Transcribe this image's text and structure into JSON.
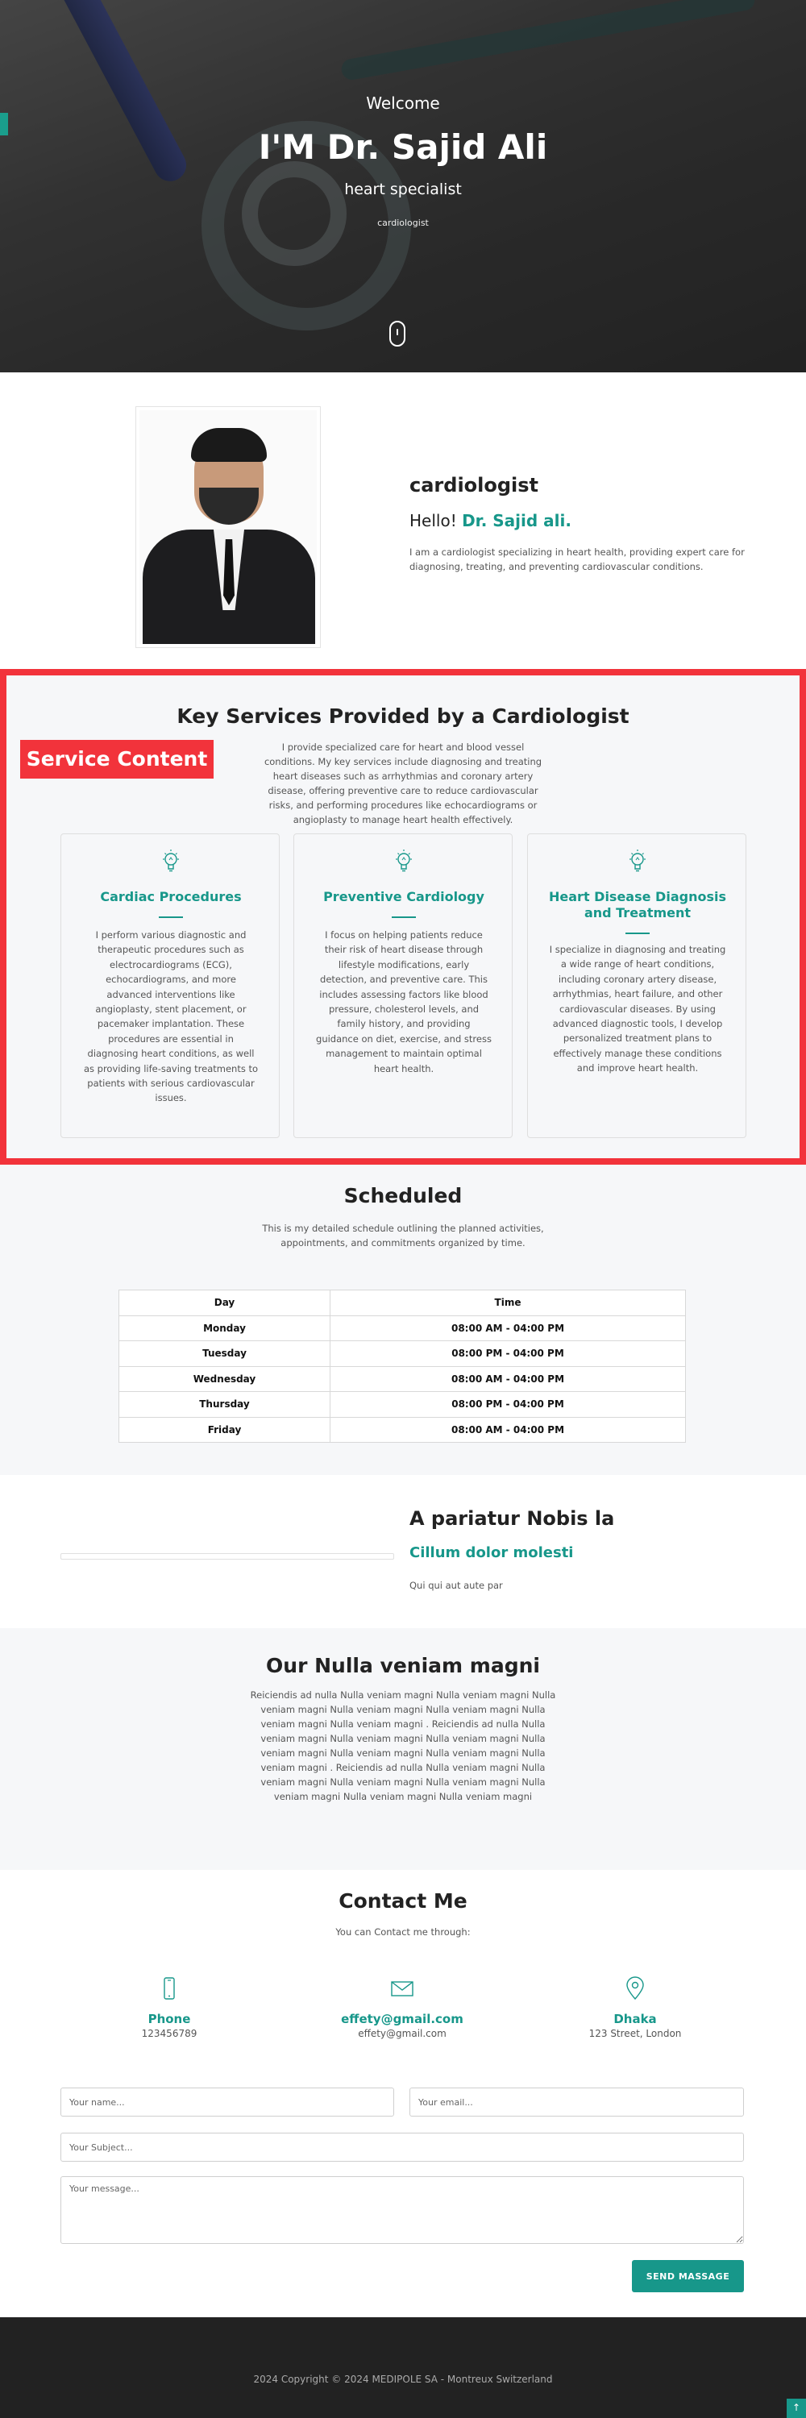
{
  "hero": {
    "welcome": "Welcome",
    "name": "I'M Dr. Sajid Ali",
    "subtitle": "heart specialist",
    "tagline": "cardiologist"
  },
  "about": {
    "title": "cardiologist",
    "hello_prefix": "Hello!",
    "hello_name": "Dr. Sajid ali.",
    "description": "I am a cardiologist specializing in heart health, providing expert care for diagnosing, treating, and preventing cardiovascular conditions."
  },
  "services": {
    "title": "Key Services Provided by a Cardiologist",
    "description": "I provide specialized care for heart and blood vessel conditions. My key services include diagnosing and treating heart diseases such as arrhythmias and coronary artery disease, offering preventive care to reduce cardiovascular risks, and performing procedures like echocardiograms or angioplasty to manage heart health effectively.",
    "badge": "Service Content",
    "cards": [
      {
        "icon": "lightbulb-icon",
        "title": "Cardiac Procedures",
        "text": "I perform various diagnostic and therapeutic procedures such as electrocardiograms (ECG), echocardiograms, and more advanced interventions like angioplasty, stent placement, or pacemaker implantation. These procedures are essential in diagnosing heart conditions, as well as providing life-saving treatments to patients with serious cardiovascular issues."
      },
      {
        "icon": "lightbulb-icon",
        "title": "Preventive Cardiology",
        "text": "I focus on helping patients reduce their risk of heart disease through lifestyle modifications, early detection, and preventive care. This includes assessing factors like blood pressure, cholesterol levels, and family history, and providing guidance on diet, exercise, and stress management to maintain optimal heart health."
      },
      {
        "icon": "lightbulb-icon",
        "title": "Heart Disease Diagnosis and Treatment",
        "text": "I specialize in diagnosing and treating a wide range of heart conditions, including coronary artery disease, arrhythmias, heart failure, and other cardiovascular diseases. By using advanced diagnostic tools, I develop personalized treatment plans to effectively manage these conditions and improve heart health."
      }
    ]
  },
  "schedule": {
    "title": "Scheduled",
    "description": "This is my detailed schedule outlining the planned activities, appointments, and commitments organized by time.",
    "headers": [
      "Day",
      "Time"
    ],
    "rows": [
      [
        "Monday",
        "08:00 AM - 04:00 PM"
      ],
      [
        "Tuesday",
        "08:00 PM - 04:00 PM"
      ],
      [
        "Wednesday",
        "08:00 AM - 04:00 PM"
      ],
      [
        "Thursday",
        "08:00 PM - 04:00 PM"
      ],
      [
        "Friday",
        "08:00 AM - 04:00 PM"
      ]
    ]
  },
  "feature": {
    "title": "A pariatur Nobis la",
    "subtitle": "Cillum dolor molesti",
    "text": "Qui qui aut aute par"
  },
  "our": {
    "title_prefix": "Our",
    "title_bold": "Nulla veniam magni",
    "text": "Reiciendis ad nulla Nulla veniam magni Nulla veniam magni Nulla veniam magni Nulla veniam magni Nulla veniam magni Nulla veniam magni Nulla veniam magni . Reiciendis ad nulla Nulla veniam magni Nulla veniam magni Nulla veniam magni Nulla veniam magni Nulla veniam magni Nulla veniam magni Nulla veniam magni . Reiciendis ad nulla Nulla veniam magni Nulla veniam magni Nulla veniam magni Nulla veniam magni Nulla veniam magni Nulla veniam magni Nulla veniam magni"
  },
  "contact": {
    "title": "Contact Me",
    "subtitle": "You can Contact me through:",
    "items": [
      {
        "icon": "phone-icon",
        "label": "Phone",
        "value": "123456789"
      },
      {
        "icon": "envelope-icon",
        "label": "effety@gmail.com",
        "value": "effety@gmail.com"
      },
      {
        "icon": "location-pin-icon",
        "label": "Dhaka",
        "value": "123 Street, London"
      }
    ],
    "form": {
      "name_placeholder": "Your name...",
      "email_placeholder": "Your email...",
      "subject_placeholder": "Your Subject...",
      "message_placeholder": "Your message...",
      "submit_label": "SEND MASSAGE"
    }
  },
  "footer": {
    "copyright": "2024 Copyright © 2024 MEDIPOLE SA - Montreux Switzerland"
  },
  "colors": {
    "accent": "#17978a",
    "highlight": "#f2333b",
    "footer_bg": "#222222"
  }
}
